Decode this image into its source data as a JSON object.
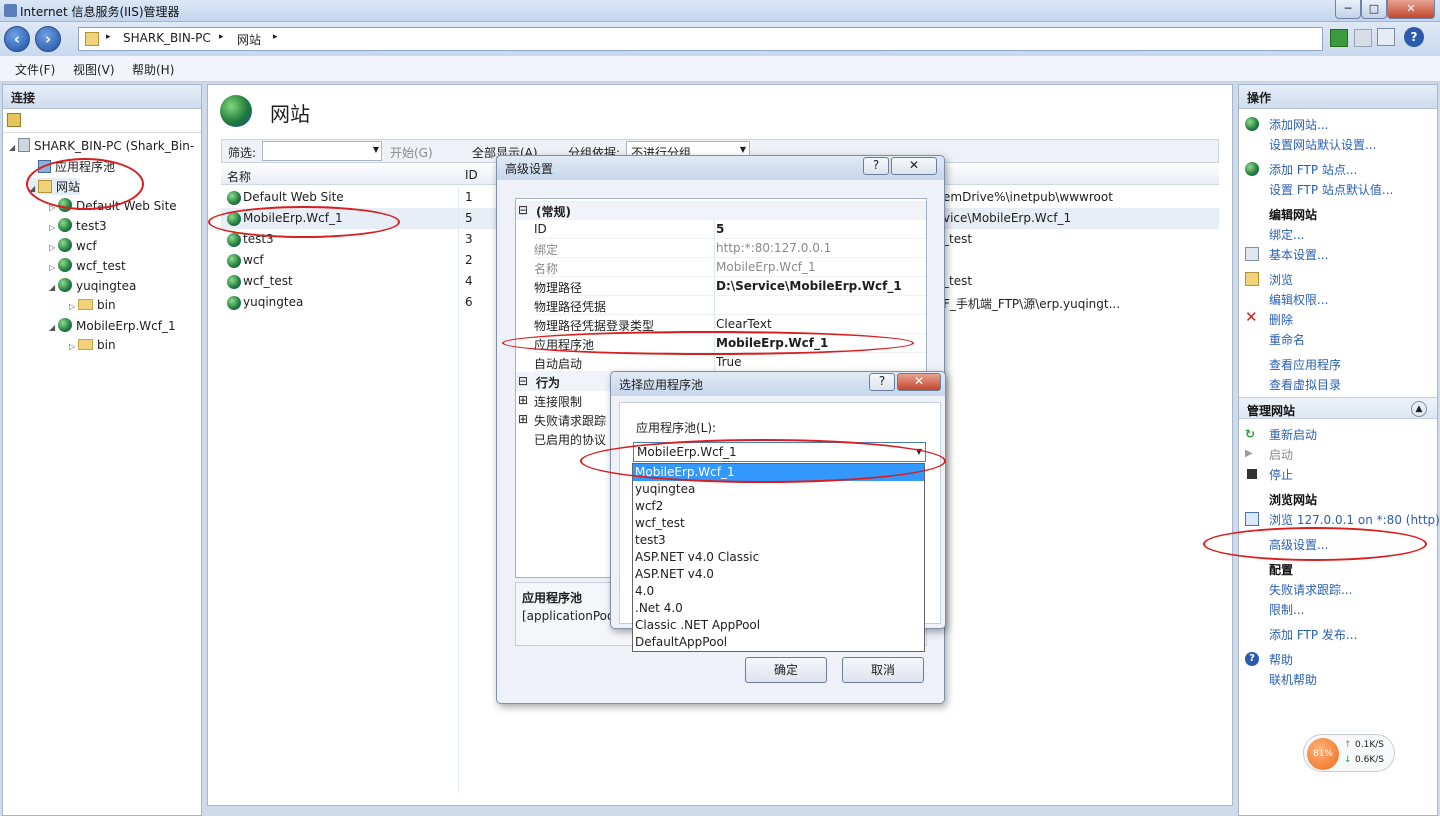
{
  "window": {
    "title": "Internet 信息服务(IIS)管理器",
    "min": "─",
    "max": "□",
    "close": "✕"
  },
  "address": {
    "segments": [
      "SHARK_BIN-PC",
      "网站"
    ],
    "sep": "▸"
  },
  "menu": [
    "文件(F)",
    "视图(V)",
    "帮助(H)"
  ],
  "connections": {
    "header": "连接",
    "tree": [
      {
        "label": "SHARK_BIN-PC (Shark_Bin-",
        "level": 0,
        "icon": "server-icon"
      },
      {
        "label": "应用程序池",
        "level": 1,
        "icon": "apppool-icon"
      },
      {
        "label": "网站",
        "level": 1,
        "icon": "sites-folder-icon"
      },
      {
        "label": "Default Web Site",
        "level": 2,
        "icon": "globe-icon"
      },
      {
        "label": "test3",
        "level": 2,
        "icon": "globe-icon"
      },
      {
        "label": "wcf",
        "level": 2,
        "icon": "globe-icon"
      },
      {
        "label": "wcf_test",
        "level": 2,
        "icon": "globe-icon"
      },
      {
        "label": "yuqingtea",
        "level": 2,
        "icon": "globe-icon"
      },
      {
        "label": "bin",
        "level": 3,
        "icon": "folder-icon"
      },
      {
        "label": "MobileErp.Wcf_1",
        "level": 2,
        "icon": "globe-icon"
      },
      {
        "label": "bin",
        "level": 3,
        "icon": "folder-icon"
      }
    ]
  },
  "main": {
    "title": "网站",
    "filter_label": "筛选:",
    "start_btn": "开始(G)",
    "show_all_btn": "全部显示(A)",
    "group_label": "分组依据:",
    "group_value": "不进行分组",
    "col_name": "名称",
    "col_id": "ID",
    "rows": [
      {
        "name": "Default Web Site",
        "id": "1",
        "path": "emDrive%\\inetpub\\wwwroot"
      },
      {
        "name": "MobileErp.Wcf_1",
        "id": "5",
        "path": "vice\\MobileErp.Wcf_1"
      },
      {
        "name": "test3",
        "id": "3",
        "path": "_test"
      },
      {
        "name": "wcf",
        "id": "2",
        "path": ""
      },
      {
        "name": "wcf_test",
        "id": "4",
        "path": "_test"
      },
      {
        "name": "yuqingtea",
        "id": "6",
        "path": "F_手机端_FTP\\源\\erp.yuqingt..."
      }
    ]
  },
  "adv": {
    "title": "高级设置",
    "help": "?",
    "close": "✕",
    "props": [
      {
        "type": "group",
        "label": "(常规)",
        "sign": "⊟"
      },
      {
        "label": "ID",
        "value": "5",
        "bold": true
      },
      {
        "label": "绑定",
        "value": "http:*:80:127.0.0.1",
        "gray": true
      },
      {
        "label": "名称",
        "value": "MobileErp.Wcf_1",
        "gray": true
      },
      {
        "label": "物理路径",
        "value": "D:\\Service\\MobileErp.Wcf_1",
        "bold": true
      },
      {
        "label": "物理路径凭据",
        "value": ""
      },
      {
        "label": "物理路径凭据登录类型",
        "value": "ClearText"
      },
      {
        "label": "应用程序池",
        "value": "MobileErp.Wcf_1",
        "bold": true
      },
      {
        "label": "自动启动",
        "value": "True"
      },
      {
        "type": "group",
        "label": "行为",
        "sign": "⊟"
      },
      {
        "type": "sub",
        "label": "连接限制",
        "sign": "⊞"
      },
      {
        "type": "sub",
        "label": "失败请求跟踪",
        "sign": "⊞"
      },
      {
        "label": "已启用的协议",
        "value": ""
      }
    ],
    "desc_title": "应用程序池",
    "desc_text": "[applicationPoo",
    "ok": "确定",
    "cancel": "取消"
  },
  "pool": {
    "title": "选择应用程序池",
    "help": "?",
    "close": "✕",
    "label": "应用程序池(L):",
    "selected": "MobileErp.Wcf_1",
    "options": [
      "MobileErp.Wcf_1",
      "yuqingtea",
      "wcf2",
      "wcf_test",
      "test3",
      "ASP.NET v4.0 Classic",
      "ASP.NET v4.0",
      "4.0",
      ".Net 4.0",
      "Classic .NET AppPool",
      "DefaultAppPool"
    ]
  },
  "actions": {
    "header": "操作",
    "add_site": "添加网站...",
    "site_defaults": "设置网站默认设置...",
    "add_ftp": "添加 FTP 站点...",
    "ftp_defaults": "设置 FTP 站点默认值...",
    "edit_site": "编辑网站",
    "bindings": "绑定...",
    "basic": "基本设置...",
    "browse": "浏览",
    "edit_perms": "编辑权限...",
    "delete": "删除",
    "rename": "重命名",
    "view_apps": "查看应用程序",
    "view_vdirs": "查看虚拟目录",
    "manage_site": "管理网站",
    "restart": "重新启动",
    "start": "启动",
    "stop": "停止",
    "browse_site": "浏览网站",
    "browse_link": "浏览 127.0.0.1 on *:80 (http)",
    "advanced": "高级设置...",
    "config": "配置",
    "failed_req": "失败请求跟踪...",
    "limits": "限制...",
    "add_ftp_pub": "添加 FTP 发布...",
    "help": "帮助",
    "online_help": "联机帮助"
  },
  "netmeter": {
    "percent": "81%",
    "up": "0.1K/S",
    "down": "0.6K/S"
  }
}
